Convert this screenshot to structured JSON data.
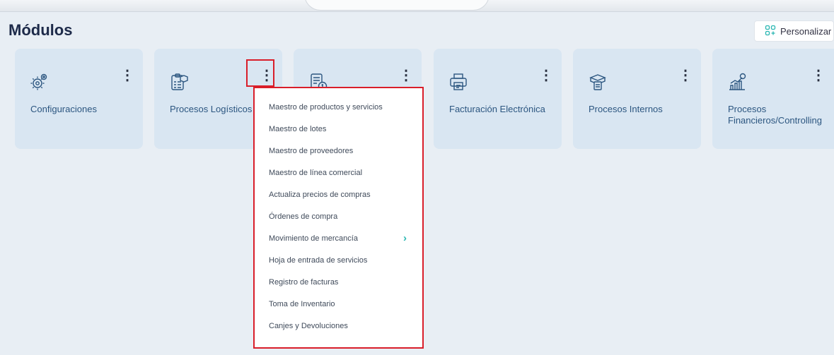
{
  "header": {
    "title": "Módulos",
    "customize_label": "Personalizar"
  },
  "cards": [
    {
      "label": "Configuraciones",
      "icon": "gears-icon"
    },
    {
      "label": "Procesos Logísticos",
      "icon": "clipboard-box-icon"
    },
    {
      "label": "",
      "icon": "invoice-coin-icon"
    },
    {
      "label": "Facturación Electrónica",
      "icon": "printer-icon"
    },
    {
      "label": "Procesos Internos",
      "icon": "box-document-icon"
    },
    {
      "label": "Procesos Financieros/Controlling",
      "icon": "chart-coin-icon"
    }
  ],
  "menu": {
    "items": [
      "Maestro de productos y servicios",
      "Maestro de lotes",
      "Maestro de proveedores",
      "Maestro de línea comercial",
      "Actualiza precios de compras",
      "Órdenes de compra",
      "Movimiento de mercancía",
      "Hoja de entrada de servicios",
      "Registro de facturas",
      "Toma de Inventario",
      "Canjes y Devoluciones"
    ],
    "submenu_item_index": 6
  },
  "colors": {
    "background": "#e8eef4",
    "card": "#d9e6f2",
    "card_text": "#2c5680",
    "title": "#1d2a49",
    "highlight": "#d91e2a",
    "chevron": "#2bb7b2"
  }
}
